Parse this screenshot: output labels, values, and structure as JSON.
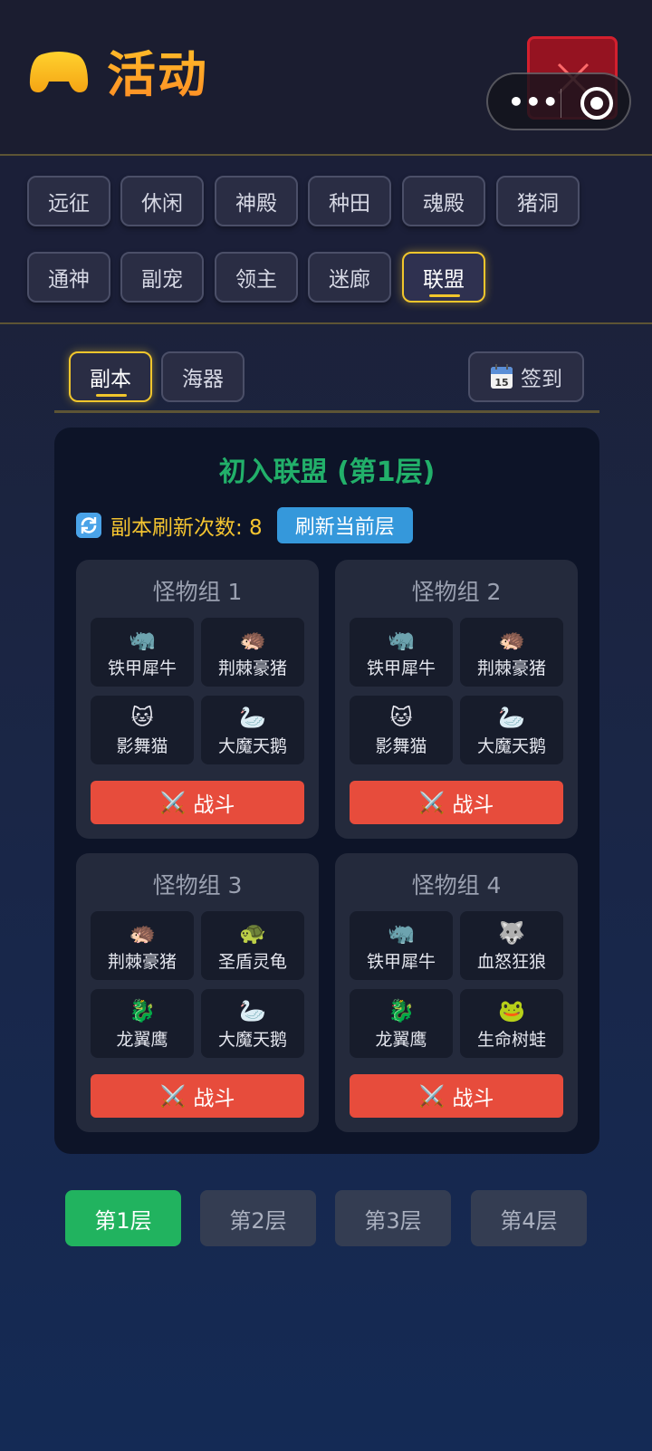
{
  "header": {
    "title": "活动",
    "title_icon": "gamepad-icon",
    "close_icon": "close-icon",
    "menu_icon": "more-dots-icon",
    "capsule_close_icon": "target-icon"
  },
  "tabs": {
    "row1": [
      "远征",
      "休闲",
      "神殿",
      "种田",
      "魂殿",
      "猪洞"
    ],
    "row2": [
      "通神",
      "副宠",
      "领主",
      "迷廊",
      "联盟"
    ],
    "active": "联盟"
  },
  "subnav": {
    "dungeon": "副本",
    "sea": "海器",
    "signin": "签到",
    "signin_icon": "calendar-icon",
    "calendar_day": "15"
  },
  "panel": {
    "title": "初入联盟 (第1层)",
    "refresh_label": "副本刷新次数: 8",
    "refresh_icon": "refresh-icon",
    "refresh_button": "刷新当前层"
  },
  "groups": [
    {
      "title": "怪物组 1",
      "monsters": [
        {
          "emoji": "🦏",
          "name": "铁甲犀牛"
        },
        {
          "emoji": "🦔",
          "name": "荆棘豪猪"
        },
        {
          "emoji": "🐱",
          "name": "影舞猫"
        },
        {
          "emoji": "🦢",
          "name": "大魔天鹅"
        }
      ],
      "fight": "战斗"
    },
    {
      "title": "怪物组 2",
      "monsters": [
        {
          "emoji": "🦏",
          "name": "铁甲犀牛"
        },
        {
          "emoji": "🦔",
          "name": "荆棘豪猪"
        },
        {
          "emoji": "🐱",
          "name": "影舞猫"
        },
        {
          "emoji": "🦢",
          "name": "大魔天鹅"
        }
      ],
      "fight": "战斗"
    },
    {
      "title": "怪物组 3",
      "monsters": [
        {
          "emoji": "🦔",
          "name": "荆棘豪猪"
        },
        {
          "emoji": "🐢",
          "name": "圣盾灵龟"
        },
        {
          "emoji": "🐉",
          "name": "龙翼鹰"
        },
        {
          "emoji": "🦢",
          "name": "大魔天鹅"
        }
      ],
      "fight": "战斗"
    },
    {
      "title": "怪物组 4",
      "monsters": [
        {
          "emoji": "🦏",
          "name": "铁甲犀牛"
        },
        {
          "emoji": "🐺",
          "name": "血怒狂狼"
        },
        {
          "emoji": "🐉",
          "name": "龙翼鹰"
        },
        {
          "emoji": "🐸",
          "name": "生命树蛙"
        }
      ],
      "fight": "战斗"
    }
  ],
  "fight_icon": "crossed-swords-icon",
  "floors": {
    "items": [
      "第1层",
      "第2层",
      "第3层",
      "第4层"
    ],
    "active": "第1层"
  },
  "colors": {
    "accent_gold": "#f1c62c",
    "title_green": "#22b06a",
    "fight_red": "#e74c3c",
    "refresh_blue": "#3598db",
    "floor_active_green": "#21b35f"
  }
}
